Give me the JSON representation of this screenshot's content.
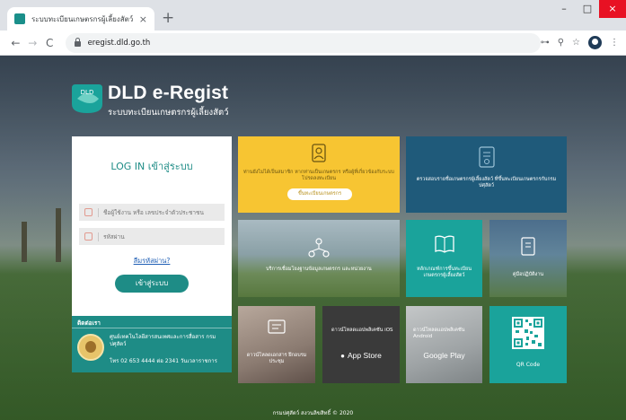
{
  "browser": {
    "tab_title": "ระบบทะเบียนเกษตรกรผู้เลี้ยงสัตว์",
    "tab_close": "×",
    "new_tab": "+",
    "url": "eregist.dld.go.th",
    "window_buttons": [
      "–",
      "□",
      "×"
    ],
    "nav": {
      "back": "←",
      "forward": "→",
      "reload": "C"
    },
    "toolbar_icons": {
      "key": "⊶",
      "zoom": "⚲",
      "star": "☆",
      "menu": "⋮"
    }
  },
  "brand": {
    "logo_text": "DLD",
    "title": "DLD e-Regist",
    "subtitle": "ระบบทะเบียนเกษตรกรผู้เลี้ยงสัตว์"
  },
  "login": {
    "title": "LOG IN เข้าสู่ระบบ",
    "username_placeholder": "ชื่อผู้ใช้งาน หรือ เลขประจำตัวประชาชน",
    "password_placeholder": "รหัสผ่าน",
    "forgot_label": "ลืมรหัสผ่าน?",
    "submit_label": "เข้าสู่ระบบ"
  },
  "contact": {
    "heading": "ติดต่อเรา",
    "name": "ศูนย์เทคโนโลยีสารสนเทศและการสื่อสาร กรมปศุสัตว์",
    "tel": "โทร 02 653 4444 ต่อ 2341 วันเวลาราชการ"
  },
  "tiles": {
    "register": {
      "caption": "ท่านยังไม่ได้เป็นสมาชิก หากท่านเป็นเกษตรกร หรือผู้ที่เกี่ยวข้องกับระบบ โปรดลงทะเบียน",
      "button": "ขึ้นทะเบียนเกษตรกร"
    },
    "check": {
      "caption": "ตรวจสอบรายชื่อเกษตรกรผู้เลี้ยงสัตว์ ที่ขึ้นทะเบียนเกษตรกรกับกรมปศุสัตว์"
    },
    "service": {
      "caption": "บริการเชื่อมโยงฐานข้อมูลเกษตรกร และหน่วยงาน"
    },
    "criteria": {
      "caption": "หลักเกณฑ์การขึ้นทะเบียน เกษตรกรผู้เลี้ยงสัตว์"
    },
    "manual": {
      "caption": "คู่มือปฏิบัติงาน"
    },
    "docs": {
      "caption": "ดาวน์โหลดเอกสาร ฝึกอบรมประชุม"
    },
    "ios": {
      "caption": "ดาวน์โหลดแอปพลิเคชัน iOS",
      "store": "App Store"
    },
    "android": {
      "caption": "ดาวน์โหลดแอปพลิเคชัน Android",
      "store": "Google Play"
    },
    "qr": {
      "caption": "QR Code"
    }
  },
  "footer": {
    "text": "กรมปศุสัตว์ สงวนลิขสิทธิ์ © 2020"
  },
  "colors": {
    "teal": "#1e8c86",
    "yellow": "#f7c532",
    "navy": "#1f5a7a",
    "aqua": "#1aa39b"
  }
}
